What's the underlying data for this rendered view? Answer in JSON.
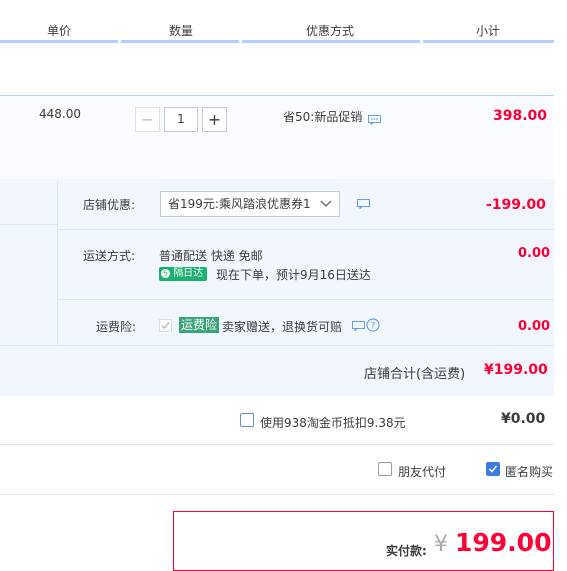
{
  "columns": {
    "unit_price": "单价",
    "quantity": "数量",
    "discount": "优惠方式",
    "subtotal": "小计"
  },
  "item": {
    "unit_price": "448.00",
    "qty_minus": "−",
    "qty_value": "1",
    "qty_plus": "+",
    "discount_text": "省50:新品促销",
    "subtotal": "398.00"
  },
  "shop": {
    "coupon_label": "店铺优惠:",
    "coupon_selected": "省199元:乘风踏浪优惠券1",
    "coupon_amount": "-199.00",
    "shipping_label": "运送方式:",
    "shipping_method": "普通配送 快递 免邮",
    "next_day_badge": "隔日达",
    "delivery_estimate": "现在下单，预计9月16日送达",
    "shipping_amount": "0.00",
    "insurance_label": "运费险:",
    "insurance_badge": "运费险",
    "insurance_text": "卖家赠送，退换货可赔",
    "insurance_amount": "0.00",
    "total_label": "店铺合计(含运费)",
    "total_amount": "¥199.00"
  },
  "taojinbi": {
    "label": "使用938淘金币抵扣9.38元",
    "amount": "¥0.00"
  },
  "options": {
    "friend_pay": "朋友代付",
    "anonymous": "匿名购买"
  },
  "payment": {
    "label": "实付款:",
    "currency": "¥",
    "amount": "199.00"
  },
  "colors": {
    "accent_red": "#ff0036",
    "header_bar": "#b2d1ff",
    "section_bg": "#f2f7ff",
    "checkbox_blue": "#3d7ce0"
  }
}
